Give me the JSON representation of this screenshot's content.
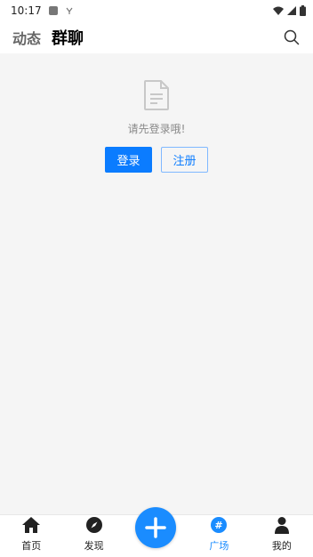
{
  "status_bar": {
    "time": "10:17"
  },
  "header": {
    "tabs": [
      {
        "label": "动态",
        "active": false
      },
      {
        "label": "群聊",
        "active": true
      }
    ]
  },
  "empty_state": {
    "message": "请先登录哦!",
    "login_label": "登录",
    "register_label": "注册"
  },
  "tabbar": {
    "items": [
      {
        "label": "首页",
        "icon": "home-icon",
        "active": false
      },
      {
        "label": "发现",
        "icon": "compass-icon",
        "active": false
      },
      {
        "label": "广场",
        "icon": "hashtag-icon",
        "active": true
      },
      {
        "label": "我的",
        "icon": "person-icon",
        "active": false
      }
    ],
    "fab_icon": "plus-icon"
  },
  "colors": {
    "accent": "#1a8cff",
    "background": "#f5f5f5"
  }
}
